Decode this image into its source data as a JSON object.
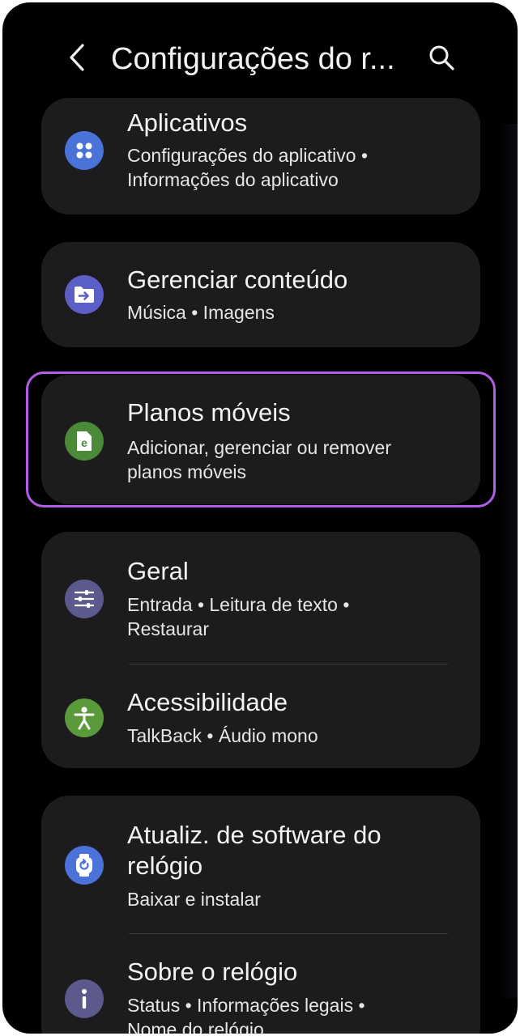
{
  "header": {
    "title": "Configurações do r..."
  },
  "items": {
    "aplicativos": {
      "label": "Aplicativos",
      "sub1": "Configurações do aplicativo •",
      "sub2": "Informações do aplicativo",
      "icon": "apps-grid-icon",
      "color": "#4a72d9"
    },
    "gerenciar": {
      "label": "Gerenciar conteúdo",
      "sub1": "Música • Imagens",
      "icon": "folder-transfer-icon",
      "color": "#5b5fc7"
    },
    "planos": {
      "label": "Planos móveis",
      "sub1": "Adicionar, gerenciar ou remover",
      "sub2": "planos móveis",
      "icon": "esim-icon",
      "color": "#4a8a38"
    },
    "geral": {
      "label": "Geral",
      "sub1": "Entrada • Leitura de texto •",
      "sub2": "Restaurar",
      "icon": "sliders-icon",
      "color": "#5c5a8c"
    },
    "acessibilidade": {
      "label": "Acessibilidade",
      "sub1": "TalkBack • Áudio mono",
      "icon": "accessibility-icon",
      "color": "#5a9a3a"
    },
    "atualiz": {
      "label1": "Atualiz. de software do",
      "label2": "relógio",
      "sub1": "Baixar e instalar",
      "icon": "watch-update-icon",
      "color": "#4a72d9"
    },
    "sobre": {
      "label": "Sobre o relógio",
      "sub1": "Status • Informações legais •",
      "sub2": "Nome do relógio",
      "icon": "info-icon",
      "color": "#5c5a8c"
    }
  }
}
